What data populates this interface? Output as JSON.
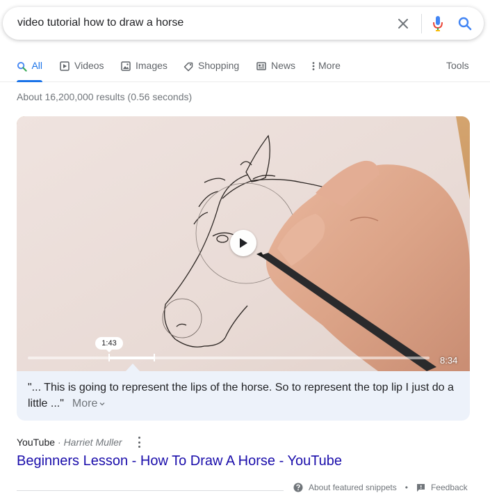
{
  "search": {
    "query": "video tutorial how to draw a horse"
  },
  "tabs": [
    {
      "label": "All",
      "icon": "search-icon",
      "active": true
    },
    {
      "label": "Videos",
      "icon": "video-icon",
      "active": false
    },
    {
      "label": "Images",
      "icon": "image-icon",
      "active": false
    },
    {
      "label": "Shopping",
      "icon": "tag-icon",
      "active": false
    },
    {
      "label": "News",
      "icon": "news-icon",
      "active": false
    },
    {
      "label": "More",
      "icon": "more-vert-icon",
      "active": false
    }
  ],
  "tools_label": "Tools",
  "result_stats": "About 16,200,000 results (0.56 seconds)",
  "video": {
    "timestamp": "1:43",
    "duration": "8:34",
    "segment_start_fraction": 0.2,
    "segment_end_fraction": 0.31,
    "transcript": "\"... This is going to represent the lips of the horse. So to represent the top lip I just do a little ...\"",
    "more_label": "More"
  },
  "source": {
    "site": "YouTube",
    "author": "· Harriet Muller"
  },
  "result_title": "Beginners Lesson - How To Draw A Horse - YouTube",
  "footer": {
    "about_label": "About featured snippets",
    "separator": "•",
    "feedback_label": "Feedback"
  },
  "colors": {
    "accent": "#1a73e8",
    "link": "#1a0dab",
    "snippet_bg": "#edf2fa"
  }
}
